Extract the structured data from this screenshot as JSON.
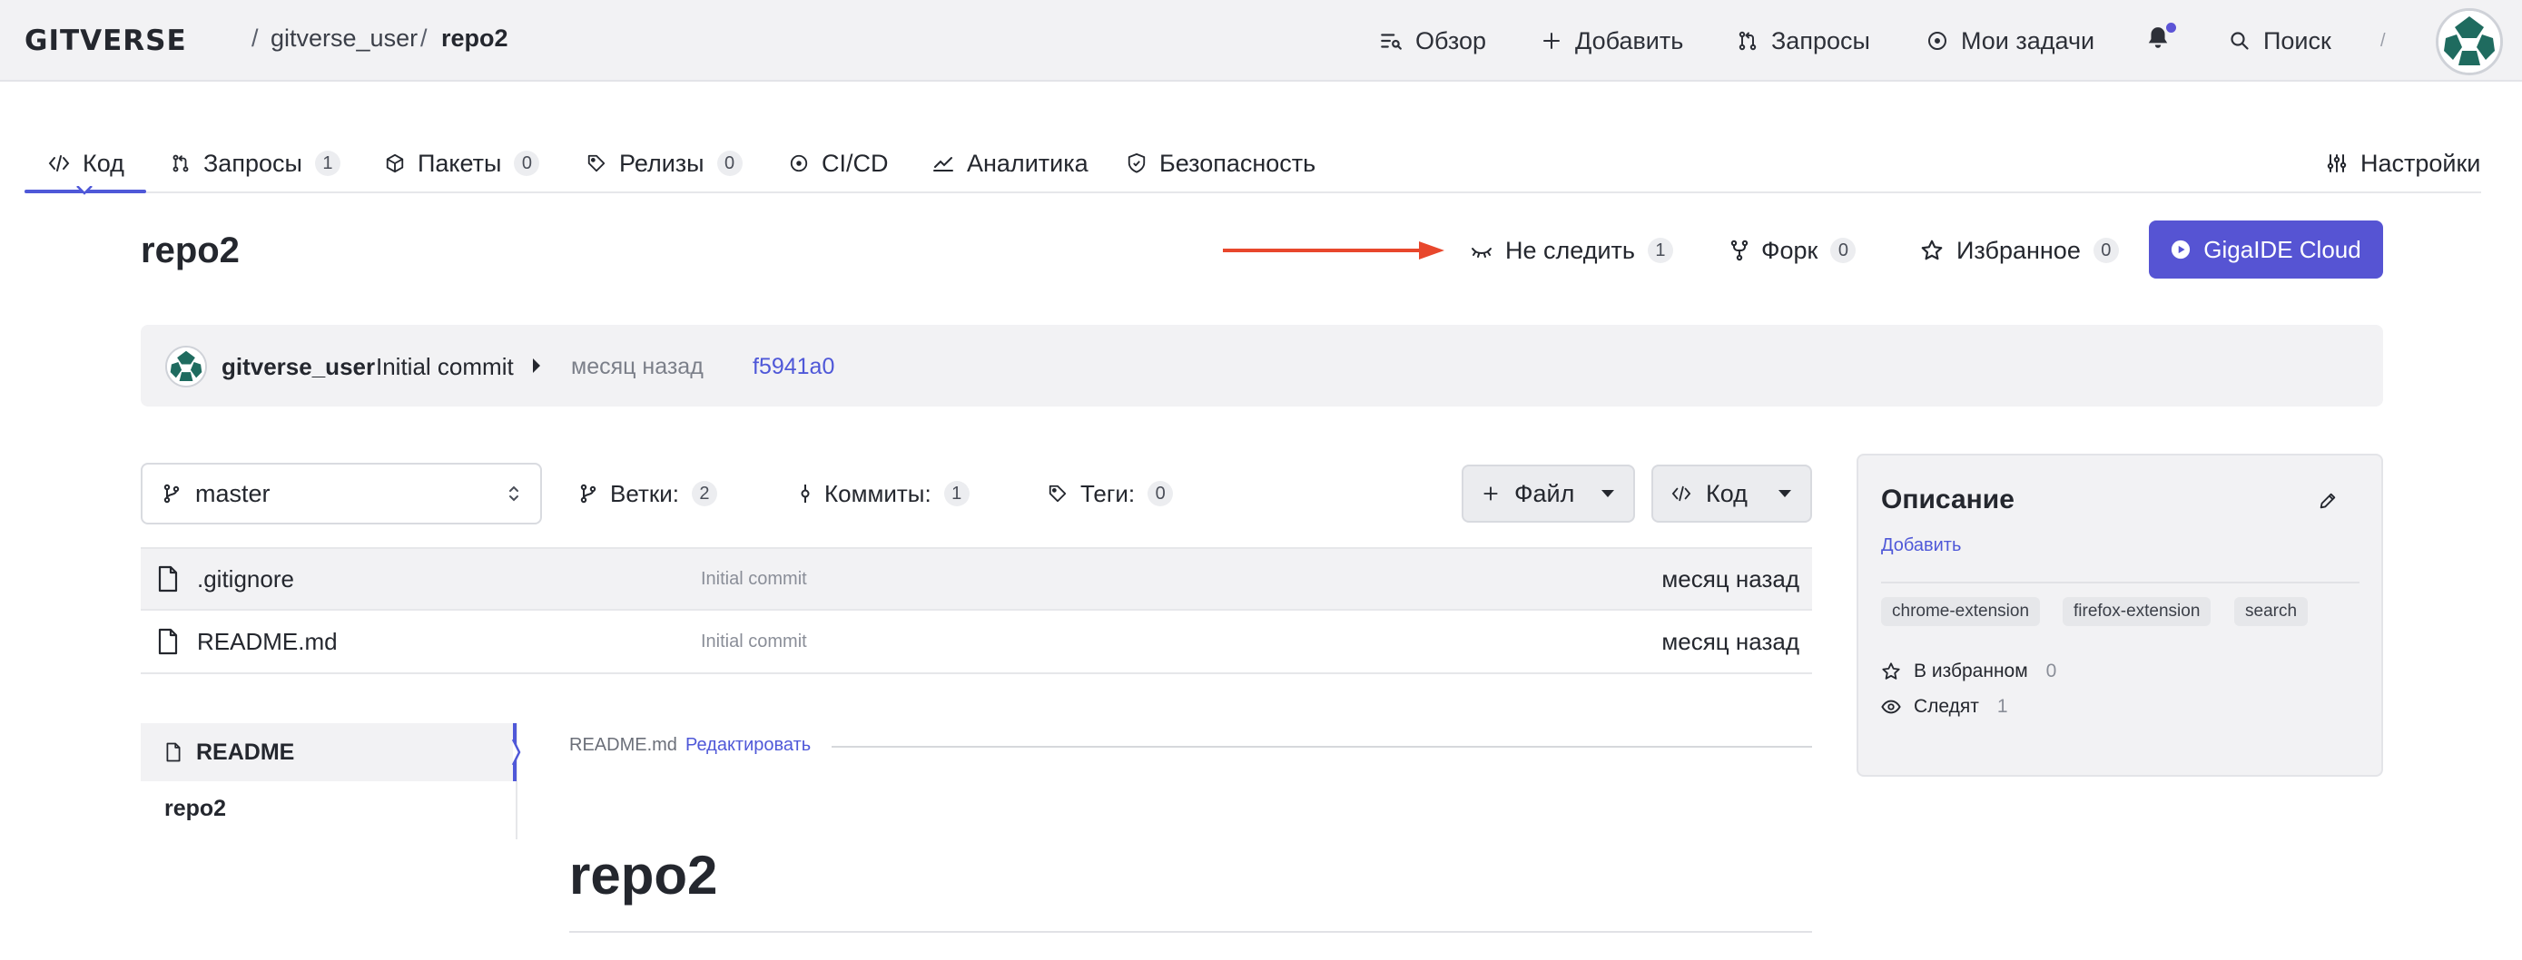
{
  "topbar": {
    "logo": "GITVERSE",
    "breadcrumb": {
      "user": "gitverse_user",
      "repo": "repo2",
      "sep": "/"
    },
    "nav": [
      {
        "label": "Обзор",
        "icon": "overview-icon"
      },
      {
        "label": "Добавить",
        "icon": "plus-icon"
      },
      {
        "label": "Запросы",
        "icon": "pull-request-icon"
      },
      {
        "label": "Мои задачи",
        "icon": "tasks-icon"
      }
    ],
    "search_label": "Поиск",
    "search_shortcut": "/"
  },
  "tabs": [
    {
      "label": "Код",
      "icon": "code-icon",
      "count": null,
      "active": true
    },
    {
      "label": "Запросы",
      "icon": "pull-request-icon",
      "count": "1"
    },
    {
      "label": "Пакеты",
      "icon": "package-icon",
      "count": "0"
    },
    {
      "label": "Релизы",
      "icon": "tag-icon",
      "count": "0"
    },
    {
      "label": "CI/CD",
      "icon": "cicd-icon",
      "count": null
    },
    {
      "label": "Аналитика",
      "icon": "analytics-icon",
      "count": null
    },
    {
      "label": "Безопасность",
      "icon": "shield-icon",
      "count": null
    }
  ],
  "settings_label": "Настройки",
  "repo": {
    "title": "repo2",
    "unwatch_label": "Не следить",
    "unwatch_count": "1",
    "fork_label": "Форк",
    "fork_count": "0",
    "star_label": "Избранное",
    "star_count": "0",
    "cloud_button": "GigaIDE Cloud"
  },
  "last_commit": {
    "author": "gitverse_user",
    "message": "Initial commit",
    "time": "месяц назад",
    "hash": "f5941a0"
  },
  "branch_bar": {
    "branch": "master",
    "branches_label": "Ветки:",
    "branches_count": "2",
    "commits_label": "Коммиты:",
    "commits_count": "1",
    "tags_label": "Теги:",
    "tags_count": "0",
    "file_button": "Файл",
    "code_button": "Код"
  },
  "files": [
    {
      "name": ".gitignore",
      "commit": "Initial commit",
      "time": "месяц назад"
    },
    {
      "name": "README.md",
      "commit": "Initial commit",
      "time": "месяц назад"
    }
  ],
  "readme": {
    "toc_active": "README",
    "toc_item": "repo2",
    "file_label": "README.md",
    "edit_label": "Редактировать",
    "heading": "repo2"
  },
  "description": {
    "title": "Описание",
    "add_label": "Добавить",
    "topics": [
      "chrome-extension",
      "firefox-extension",
      "search"
    ],
    "favorites_label": "В избранном",
    "favorites_count": "0",
    "watchers_label": "Следят",
    "watchers_count": "1"
  },
  "colors": {
    "accent": "#5654d3",
    "annotation_arrow": "#e8472c"
  }
}
